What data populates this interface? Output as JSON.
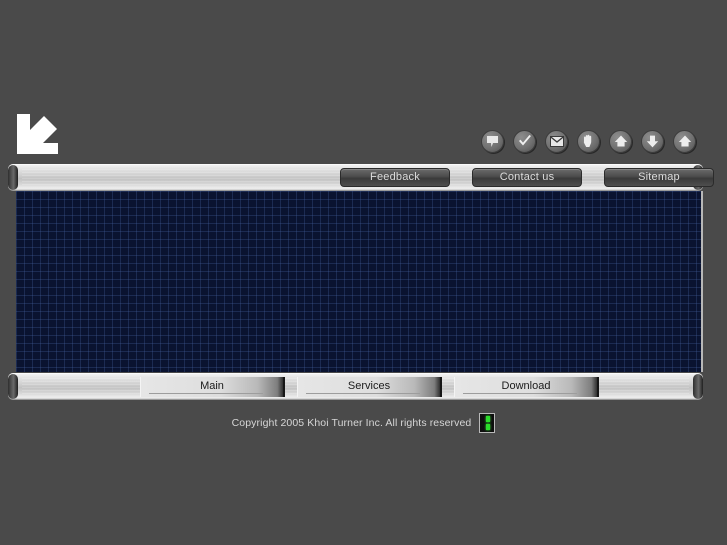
{
  "page": {
    "background_color": "#4a4a4a",
    "content_background_color": "#0a1330",
    "grid_line_color": "#4662a0",
    "accent_green": "#2bdc2b"
  },
  "logo": {
    "name": "diagonal-arrow-logo",
    "color": "#ffffff",
    "direction": "down-left"
  },
  "icon_strip": {
    "items": [
      {
        "name": "chat-bubble-icon",
        "glyph": "speech-bubble"
      },
      {
        "name": "check-icon",
        "glyph": "checkmark"
      },
      {
        "name": "mail-icon",
        "glyph": "envelope"
      },
      {
        "name": "hand-icon",
        "glyph": "hand"
      },
      {
        "name": "home-icon",
        "glyph": "house"
      },
      {
        "name": "down-arrow-icon",
        "glyph": "arrow-down"
      },
      {
        "name": "home-alt-icon",
        "glyph": "house"
      }
    ]
  },
  "top_nav": {
    "buttons": [
      {
        "label": "Feedback"
      },
      {
        "label": "Contact us"
      },
      {
        "label": "Sitemap"
      }
    ]
  },
  "bottom_nav": {
    "buttons": [
      {
        "label": "Main"
      },
      {
        "label": "Services"
      },
      {
        "label": "Download"
      }
    ]
  },
  "content": {
    "text": ""
  },
  "footer": {
    "copyright": "Copyright 2005 Khoi Turner Inc. All rights reserved",
    "indicator_name": "green-led-indicator"
  }
}
